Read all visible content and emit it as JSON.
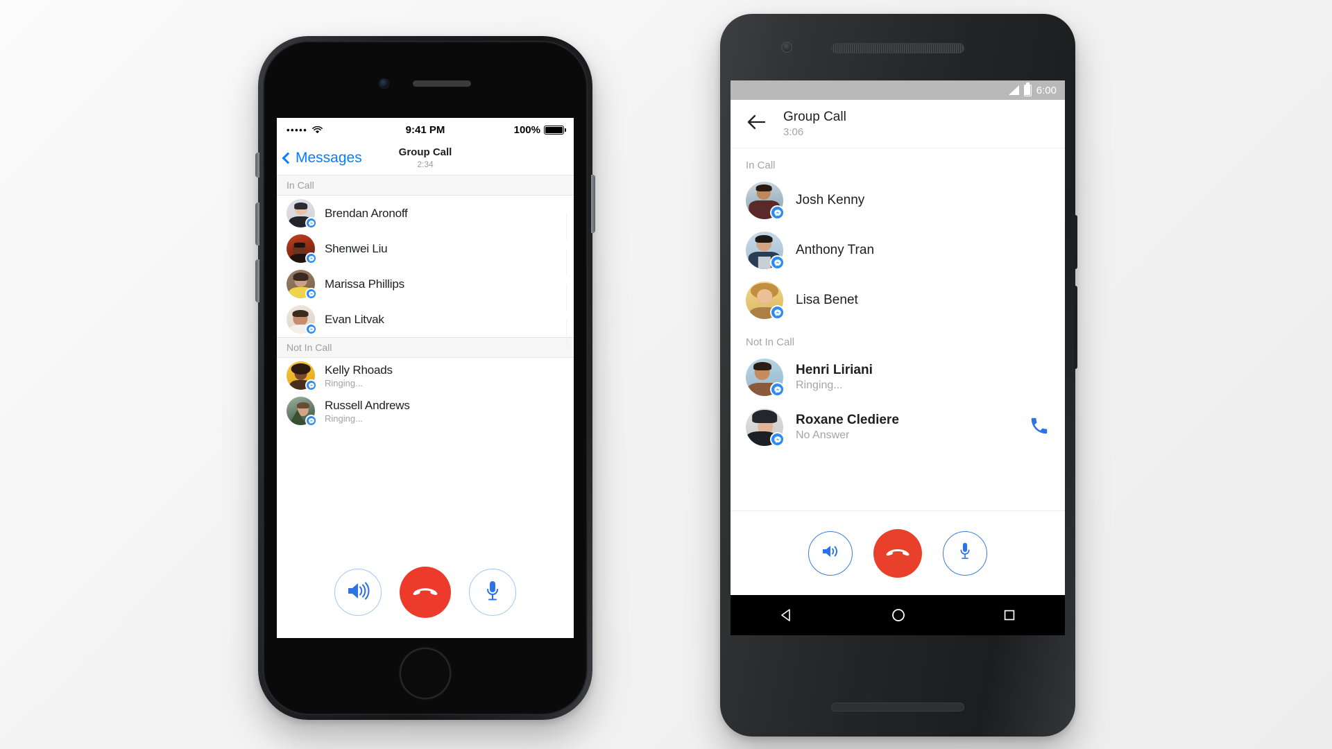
{
  "scene": {
    "description": "Facebook Messenger group call screens shown on an iPhone and an Android phone"
  },
  "iphone": {
    "status_bar": {
      "carrier_dots": "•••••",
      "wifi_icon": "wifi-icon",
      "time": "9:41 PM",
      "battery_percent": "100%",
      "battery_icon": "battery-full-icon"
    },
    "nav": {
      "back_icon": "chevron-left-icon",
      "back_label": "Messages",
      "title": "Group Call",
      "duration": "2:34"
    },
    "sections": [
      {
        "header": "In Call",
        "rows": [
          {
            "name": "Brendan Aronoff",
            "status": "",
            "avatar_colors": [
              "#dcdde2",
              "#2b2b31"
            ],
            "badge": "messenger-badge-icon"
          },
          {
            "name": "Shenwei Liu",
            "status": "",
            "avatar_colors": [
              "#a8351f",
              "#4a2218"
            ],
            "badge": "messenger-badge-icon"
          },
          {
            "name": "Marissa Phillips",
            "status": "",
            "avatar_colors": [
              "#8a7360",
              "#efd34a"
            ],
            "badge": "messenger-badge-icon"
          },
          {
            "name": "Evan Litvak",
            "status": "",
            "avatar_colors": [
              "#e7dcd3",
              "#8e6a58"
            ],
            "badge": "messenger-badge-icon"
          }
        ]
      },
      {
        "header": "Not In Call",
        "rows": [
          {
            "name": "Kelly Rhoads",
            "status": "Ringing...",
            "avatar_colors": [
              "#f2b829",
              "#4a2e1c"
            ],
            "badge": "messenger-badge-icon"
          },
          {
            "name": "Russell Andrews",
            "status": "Ringing...",
            "avatar_colors": [
              "#7e8f7a",
              "#3c4d3f"
            ],
            "badge": "messenger-badge-icon"
          }
        ]
      }
    ],
    "controls": [
      {
        "name": "speaker-button",
        "icon": "speaker-icon",
        "style": "outline"
      },
      {
        "name": "end-call-button",
        "icon": "hangup-icon",
        "style": "danger"
      },
      {
        "name": "mute-button",
        "icon": "microphone-icon",
        "style": "outline"
      }
    ]
  },
  "android": {
    "status_bar": {
      "signal_icon": "signal-bars-icon",
      "battery_icon": "battery-full-icon",
      "time": "6:00"
    },
    "app_bar": {
      "back_icon": "arrow-left-icon",
      "title": "Group Call",
      "duration": "3:06"
    },
    "sections": [
      {
        "header": "In Call",
        "rows": [
          {
            "name": "Josh Kenny",
            "status": "",
            "bold": false,
            "avatar_colors": [
              "#c9d6de",
              "#5a2a2a"
            ],
            "badge": "messenger-badge-icon",
            "action": ""
          },
          {
            "name": "Anthony Tran",
            "status": "",
            "bold": false,
            "avatar_colors": [
              "#b9cfe2",
              "#2b3d52"
            ],
            "badge": "messenger-badge-icon",
            "action": ""
          },
          {
            "name": "Lisa Benet",
            "status": "",
            "bold": false,
            "avatar_colors": [
              "#e8c96a",
              "#a07040"
            ],
            "badge": "messenger-badge-icon",
            "action": ""
          }
        ]
      },
      {
        "header": "Not In Call",
        "rows": [
          {
            "name": "Henri Liriani",
            "status": "Ringing...",
            "bold": true,
            "avatar_colors": [
              "#a9c6d8",
              "#6b4b3a"
            ],
            "badge": "messenger-badge-icon",
            "action": ""
          },
          {
            "name": "Roxane Clediere",
            "status": "No Answer",
            "bold": true,
            "avatar_colors": [
              "#d8d8d8",
              "#23262b"
            ],
            "badge": "messenger-badge-icon",
            "action": "redial-call-icon"
          }
        ]
      }
    ],
    "controls": [
      {
        "name": "speaker-button",
        "icon": "speaker-icon",
        "style": "outline"
      },
      {
        "name": "end-call-button",
        "icon": "hangup-icon",
        "style": "danger"
      },
      {
        "name": "mute-button",
        "icon": "microphone-icon",
        "style": "outline"
      }
    ],
    "nav_bar": [
      {
        "name": "android-back-button",
        "icon": "triangle-back-icon"
      },
      {
        "name": "android-home-button",
        "icon": "circle-home-icon"
      },
      {
        "name": "android-recents-button",
        "icon": "square-recents-icon"
      }
    ]
  },
  "colors": {
    "messenger_blue": "#2c8cf7",
    "ios_link_blue": "#0a7cff",
    "end_call_red": "#ec3b2b",
    "android_end_call_red": "#e8402a",
    "android_accent_blue": "#3b7dd8",
    "muted_text": "#a2a5a9"
  }
}
